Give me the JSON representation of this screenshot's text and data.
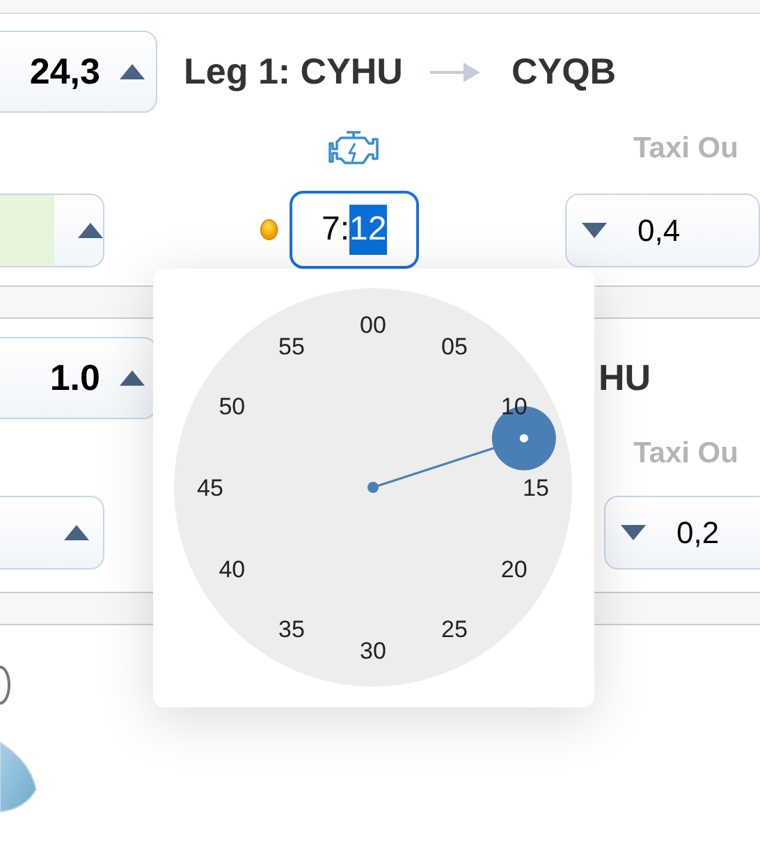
{
  "leg_1": {
    "distance": "24,3",
    "title": "Leg 1: CYHU",
    "destination": "CYQB",
    "fuel_field": {
      "highlighted": true
    },
    "time_field": {
      "hours": "7:",
      "minutes": "12",
      "minutes_selected": true,
      "focused": true
    },
    "taxi_out_label": "Taxi Ou",
    "taxi_out": "0,4"
  },
  "leg_2": {
    "distance": "1.0",
    "title_fragment": "HU",
    "taxi_out_label": "Taxi Ou",
    "taxi_out": "0,2"
  },
  "minute_picker": {
    "labels": [
      "00",
      "05",
      "10",
      "15",
      "20",
      "25",
      "30",
      "35",
      "40",
      "45",
      "50",
      "55"
    ]
  }
}
